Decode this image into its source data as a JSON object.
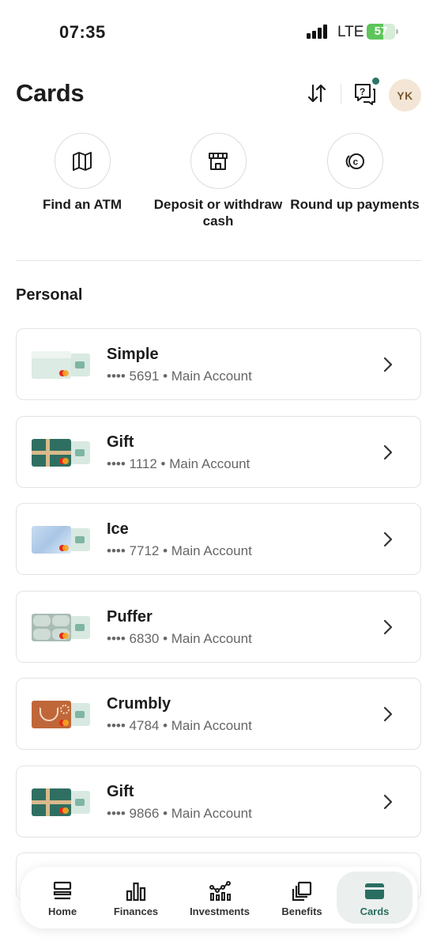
{
  "status_bar": {
    "time": "07:35",
    "network": "LTE",
    "battery": "57",
    "battery_level": 0.57
  },
  "header": {
    "title": "Cards",
    "avatar_initials": "YK"
  },
  "quick_actions": [
    {
      "label": "Find an ATM",
      "icon": "map-icon"
    },
    {
      "label": "Deposit or withdraw cash",
      "icon": "store-icon"
    },
    {
      "label": "Round up payments",
      "icon": "coins-icon"
    }
  ],
  "section": {
    "title": "Personal"
  },
  "cards": [
    {
      "name": "Simple",
      "detail": "•••• 5691 • Main Account",
      "design": "simple"
    },
    {
      "name": "Gift",
      "detail": "•••• 1112 • Main Account",
      "design": "gift"
    },
    {
      "name": "Ice",
      "detail": "•••• 7712 • Main Account",
      "design": "ice"
    },
    {
      "name": "Puffer",
      "detail": "•••• 6830 • Main Account",
      "design": "puffer"
    },
    {
      "name": "Crumbly",
      "detail": "•••• 4784 • Main Account",
      "design": "crumbly"
    },
    {
      "name": "Gift",
      "detail": "•••• 9866 • Main Account",
      "design": "gift"
    }
  ],
  "nav": [
    {
      "label": "Home",
      "icon": "home-icon"
    },
    {
      "label": "Finances",
      "icon": "bar-chart-icon"
    },
    {
      "label": "Investments",
      "icon": "trend-icon"
    },
    {
      "label": "Benefits",
      "icon": "stack-icon"
    },
    {
      "label": "Cards",
      "icon": "card-icon",
      "active": true
    }
  ],
  "colors": {
    "accent": "#2a6e62",
    "notification_dot": "#2e7566",
    "battery_green": "#5ec55a"
  }
}
